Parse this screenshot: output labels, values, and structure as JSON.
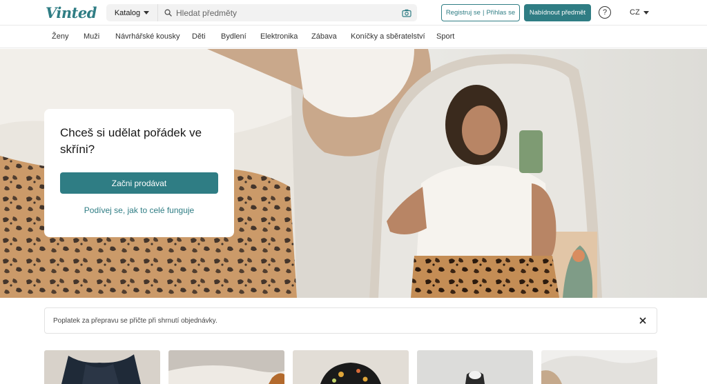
{
  "header": {
    "logo": "Vinted",
    "catalog_label": "Katalog",
    "search_placeholder": "Hledat předměty",
    "register_label": "Registruj se",
    "separator": "|",
    "login_label": "Přihlas se",
    "sell_label": "Nabídnout předmět",
    "help_symbol": "?",
    "language": "CZ"
  },
  "nav": {
    "items": [
      "Ženy",
      "Muži",
      "Návrhářské kousky",
      "Děti",
      "Bydlení",
      "Elektronika",
      "Zábava",
      "Koníčky a sběratelství",
      "Sport"
    ]
  },
  "hero": {
    "title": "Chceš si udělat pořádek ve skříni?",
    "cta_label": "Začni prodávat",
    "link_label": "Podívej se, jak to celé funguje"
  },
  "notice": {
    "text": "Poplatek za přepravu se přičte při shrnutí objednávky."
  },
  "icons": {
    "search": "search-icon",
    "camera": "camera-icon",
    "help": "help-icon",
    "close": "close-icon",
    "caret": "chevron-down-icon"
  },
  "colors": {
    "brand": "#2f7d84",
    "text": "#171717",
    "search_bg": "#f2f2f2"
  }
}
